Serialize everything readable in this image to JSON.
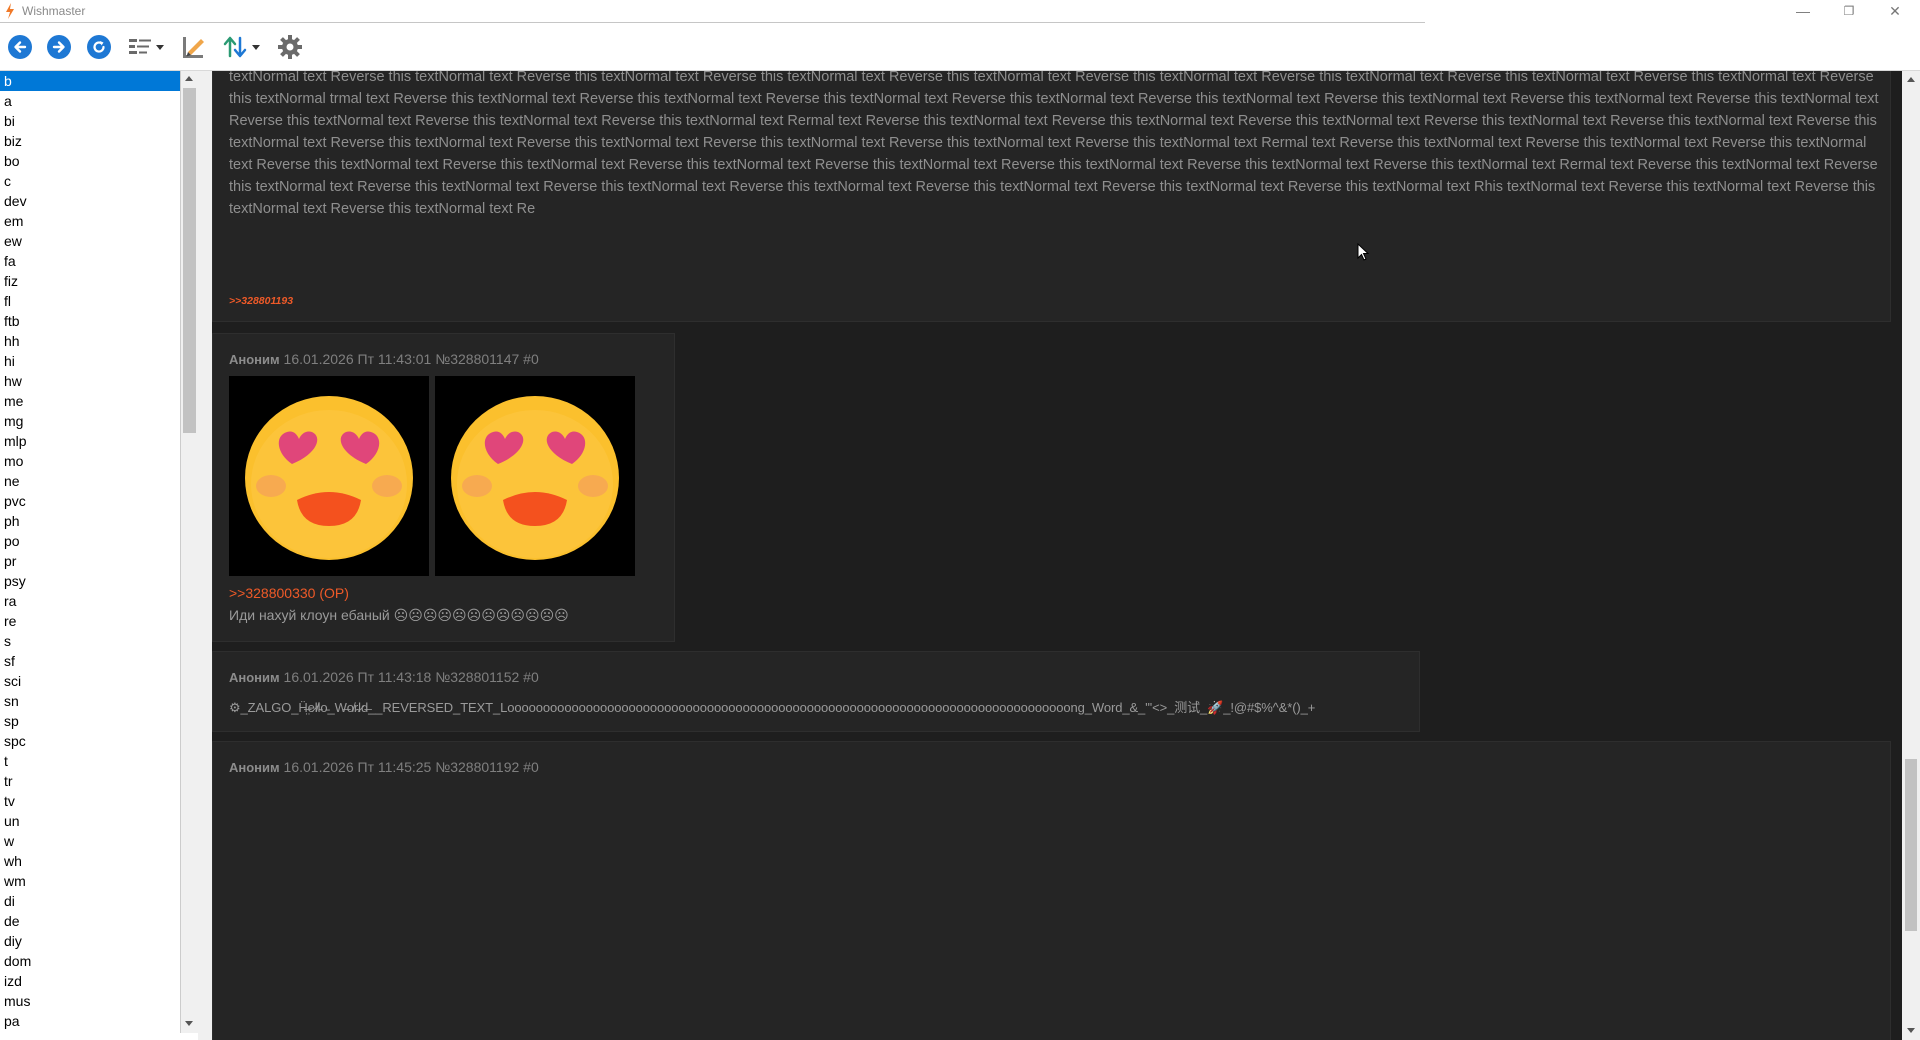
{
  "window": {
    "title": "Wishmaster",
    "controls": [
      "—",
      "❐",
      "✕"
    ]
  },
  "toolbar": {
    "buttons": [
      "back-icon",
      "forward-icon",
      "refresh-icon",
      "view-list-icon",
      "write-icon",
      "sort-icon",
      "settings-icon"
    ]
  },
  "boards": [
    "b",
    "a",
    "bi",
    "biz",
    "bo",
    "c",
    "dev",
    "em",
    "ew",
    "fa",
    "fiz",
    "fl",
    "ftb",
    "hh",
    "hi",
    "hw",
    "me",
    "mg",
    "mlp",
    "mo",
    "ne",
    "pvc",
    "ph",
    "po",
    "pr",
    "psy",
    "ra",
    "re",
    "s",
    "sf",
    "sci",
    "sn",
    "sp",
    "spc",
    "t",
    "tr",
    "tv",
    "un",
    "w",
    "wh",
    "wm",
    "di",
    "de",
    "diy",
    "dom",
    "izd",
    "mus",
    "pa"
  ],
  "selected_board": "b",
  "colors": {
    "accent": "#0078d7",
    "reply_link": "#ef5a28",
    "content_bg": "#1e1e1e",
    "post_bg": "#252525"
  },
  "posts": [
    {
      "text": "textNormal text Reverse this textNormal text Reverse this textNormal text Reverse this textNormal text Reverse this textNormal text Reverse this textNormal text Reverse this textNormal text Reverse this textNormal text Reverse this textNormal text Reverse this textNormal trmal text Reverse this textNormal text Reverse this textNormal text Reverse this textNormal text Reverse this textNormal text Reverse this textNormal text Reverse this textNormal text Reverse this textNormal text Reverse this textNormal text Reverse this textNormal text Reverse this textNormal text Reverse this textNormal text Rermal text Reverse this textNormal text Reverse this textNormal text Reverse this textNormal text Reverse this textNormal text Reverse this textNormal text Reverse this textNormal text Reverse this textNormal text Reverse this textNormal text Reverse this textNormal text Reverse this textNormal text Reverse this textNormal text Rermal text Reverse this textNormal text Reverse this textNormal text Reverse this textNormal text Reverse this textNormal text Reverse this textNormal text Reverse this textNormal text Reverse this textNormal text Reverse this textNormal text Reverse this textNormal text Reverse this textNormal text Rermal text Reverse this textNormal text Reverse this textNormal text Reverse this textNormal text Reverse this textNormal text Reverse this textNormal text Reverse this textNormal text Reverse this textNormal text Reverse this textNormal text Rhis textNormal text Reverse this textNormal text Reverse this textNormal text Reverse this textNormal text Re",
      "reply_link": ">>328801193"
    },
    {
      "author": "Аноним",
      "date": "16.01.2026 Пт 11:43:01",
      "number": "№328801147",
      "index": "#0",
      "images": [
        "smiling-face-with-heart-eyes",
        "smiling-face-with-heart-eyes"
      ],
      "reply_link": ">>328800330 (OP)",
      "text": "Иди нахуй клоун ебаный ☹☹☹☹☹☹☹☹☹☹☹☹"
    },
    {
      "author": "Аноним",
      "date": "16.01.2026 Пт 11:43:18",
      "number": "№328801152",
      "index": "#0",
      "text": "⚙_ZALGO_Ḧ̶̤e̷l̸l̴o̵_W̶o̸r̴l̷d̶__REVERSED_TEXT_Looooooooooooooooooooooooooooooooooooooooooooooooooooooooooooooooooooooooooooooong_Word_&_\"'<>_测试_🚀_!@#$%^&*()_+"
    },
    {
      "author": "Аноним",
      "date": "16.01.2026 Пт 11:45:25",
      "number": "№328801192",
      "index": "#0"
    }
  ]
}
